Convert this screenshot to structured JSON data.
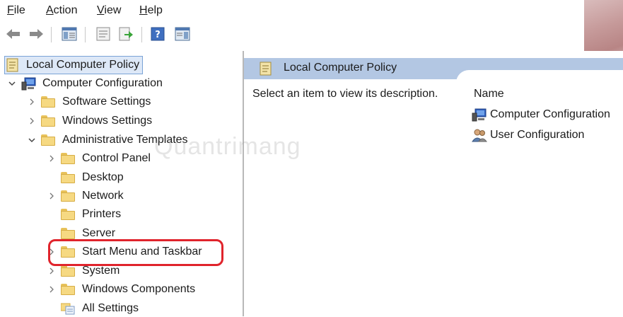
{
  "menu": {
    "file": {
      "underline": "F",
      "rest": "ile"
    },
    "action": {
      "underline": "A",
      "rest": "ction"
    },
    "view": {
      "underline": "V",
      "rest": "iew"
    },
    "help": {
      "underline": "H",
      "rest": "elp"
    }
  },
  "toolbar": {
    "icons": [
      "back-arrow-icon",
      "forward-arrow-icon",
      "show-hide-console-tree-icon",
      "properties-icon",
      "export-list-icon",
      "help-icon",
      "show-action-pane-icon"
    ]
  },
  "tree": {
    "root": "Local Computer Policy",
    "computer_configuration": "Computer Configuration",
    "software_settings": "Software Settings",
    "windows_settings": "Windows Settings",
    "administrative_templates": "Administrative Templates",
    "control_panel": "Control Panel",
    "desktop": "Desktop",
    "network": "Network",
    "printers": "Printers",
    "server": "Server",
    "start_menu": "Start Menu and Taskbar",
    "system": "System",
    "windows_components": "Windows Components",
    "all_settings": "All Settings"
  },
  "right_pane": {
    "header_title": "Local Computer Policy",
    "description": "Select an item to view its description.",
    "column_name": "Name",
    "items": [
      "Computer Configuration",
      "User Configuration"
    ]
  },
  "watermark": "Quantrimang",
  "colors": {
    "header_bg": "#b3c7e3",
    "selection_bg": "#dde8f7",
    "highlight": "#e0242c",
    "folder": "#f6d982"
  }
}
